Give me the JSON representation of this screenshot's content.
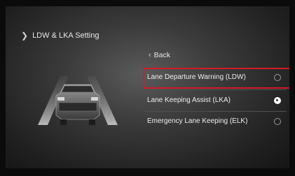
{
  "header": {
    "title": "LDW & LKA Setting",
    "chevron_icon": "chevron-right-icon"
  },
  "back": {
    "label": "Back",
    "icon": "chevron-left-icon"
  },
  "options": [
    {
      "label": "Lane Departure Warning (LDW)",
      "selected": false
    },
    {
      "label": "Lane Keeping Assist (LKA)",
      "selected": true
    },
    {
      "label": "Emergency Lane Keeping (ELK)",
      "selected": false
    }
  ],
  "colors": {
    "highlight": "#d61a25",
    "background": "#2e2e2e",
    "text": "#eeeeee"
  }
}
